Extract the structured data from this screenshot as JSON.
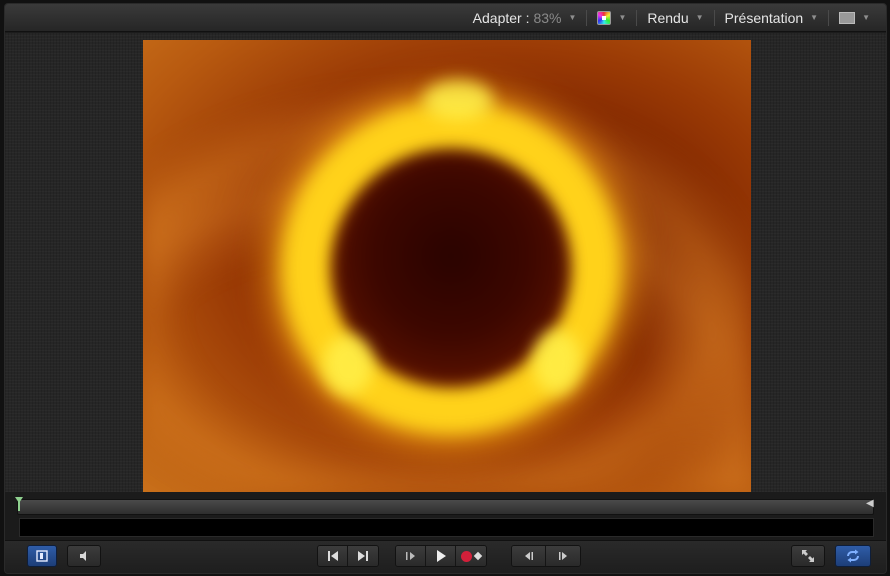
{
  "toolbar": {
    "fit_label": "Adapter :",
    "fit_value": "83%",
    "render_label": "Rendu",
    "view_label": "Présentation"
  },
  "icons": {
    "color_channels": "color-channels-icon",
    "layout": "layout-icon",
    "safe_zone": "safe-zone-icon",
    "mute": "mute-icon",
    "go_start": "go-to-start-icon",
    "go_end": "go-to-end-icon",
    "play_from_start": "play-from-start-icon",
    "play": "play-icon",
    "record": "record-icon",
    "step_back": "step-back-icon",
    "step_forward": "step-forward-icon",
    "fullscreen": "fullscreen-icon",
    "loop": "loop-icon"
  },
  "colors": {
    "accent_blue": "#2f5da8",
    "record_red": "#d3203a",
    "playhead_green": "#8fd18f"
  },
  "timeline": {
    "playhead_position": 0
  }
}
